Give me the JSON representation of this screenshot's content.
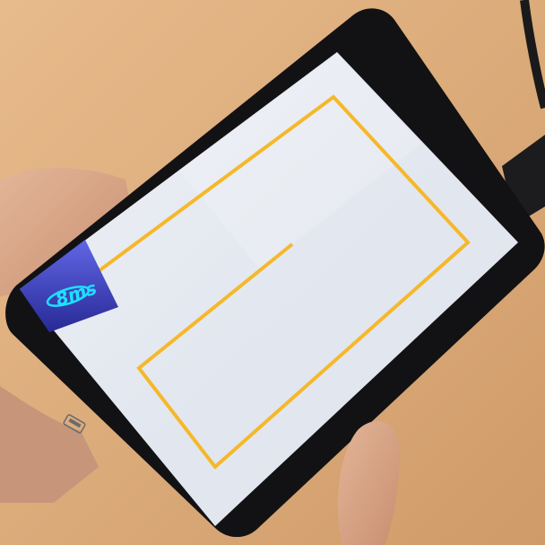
{
  "photo": {
    "subject": "handheld-touchscreen-device",
    "colors": {
      "table": "#dcaa78",
      "bezel": "#121214",
      "screen": "#e6eaf2",
      "path_line": "#f5b82a",
      "logo_tile_top": "#5a5fe0",
      "logo_tile_bottom": "#2a2c9a",
      "logo_glyph": "#1ee0ff",
      "skin": "#d9a98a"
    },
    "logo": {
      "text": "8ms",
      "icon": "orbit-ring-icon"
    },
    "connector_icon": "usb-port-icon"
  }
}
